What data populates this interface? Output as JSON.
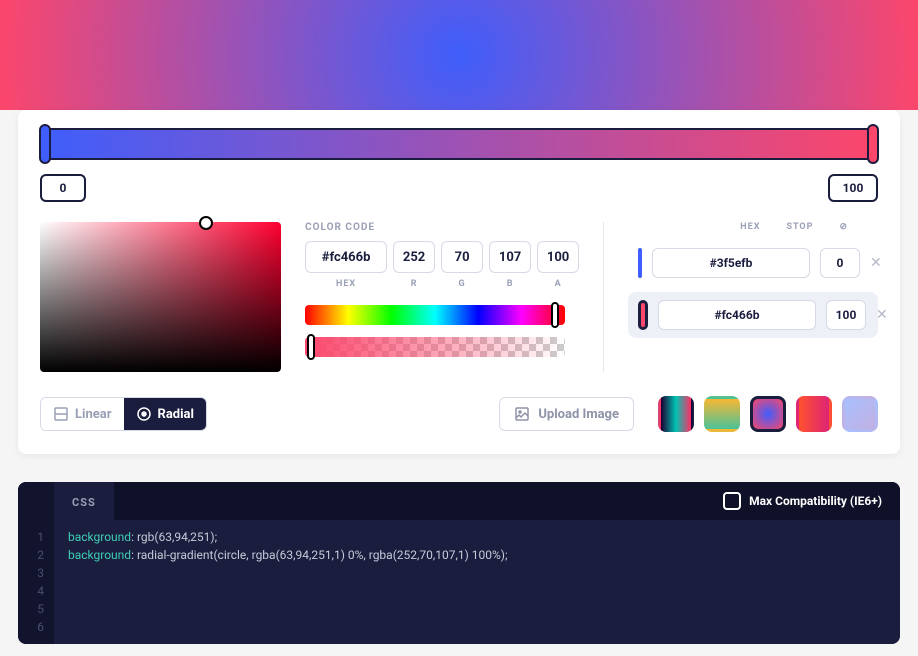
{
  "gradient": {
    "type": "radial",
    "stops": [
      {
        "hex": "#3f5efb",
        "position": 0
      },
      {
        "hex": "#fc466b",
        "position": 100
      }
    ],
    "active_stop_index": 1
  },
  "slider": {
    "left_position": "0",
    "right_position": "100"
  },
  "color_code": {
    "label": "COLOR CODE",
    "hex_label": "HEX",
    "r_label": "R",
    "g_label": "G",
    "b_label": "B",
    "a_label": "A",
    "hex": "#fc466b",
    "r": "252",
    "g": "70",
    "b": "107",
    "a": "100"
  },
  "stops_panel": {
    "hex_header": "HEX",
    "stop_header": "STOP",
    "delete_header": "⊘",
    "rows": [
      {
        "hex": "#3f5efb",
        "pos": "0",
        "color": "#3f5efb",
        "active": false
      },
      {
        "hex": "#fc466b",
        "pos": "100",
        "color": "#fc466b",
        "active": true
      }
    ]
  },
  "type_toggle": {
    "linear_label": "Linear",
    "radial_label": "Radial"
  },
  "upload": {
    "label": "Upload Image"
  },
  "presets": [
    {
      "css": "linear-gradient(90deg,#1a0033,#00c4b4,#ff2e63)"
    },
    {
      "css": "linear-gradient(180deg,#f7b733,#4ac29a)"
    },
    {
      "css": "radial-gradient(circle,#3f5efb,#fc466b)"
    },
    {
      "css": "linear-gradient(90deg,#ff512f,#dd2476)"
    },
    {
      "css": "linear-gradient(135deg,#a8c0ff,#c2b0e2)"
    }
  ],
  "code": {
    "tab_label": "CSS",
    "compat_label": "Max Compatibility (IE6+)",
    "lines": [
      {
        "keyword": "background",
        "rest": ": rgb(63,94,251);"
      },
      {
        "keyword": "background",
        "rest": ": radial-gradient(circle, rgba(63,94,251,1) 0%, rgba(252,70,107,1) 100%);"
      },
      {
        "keyword": "",
        "rest": ""
      },
      {
        "keyword": "",
        "rest": ""
      },
      {
        "keyword": "",
        "rest": ""
      },
      {
        "keyword": "",
        "rest": ""
      }
    ]
  },
  "chart_data": {
    "type": "gradient-editor",
    "gradient_type": "radial",
    "stops": [
      {
        "color": "rgb(63,94,251)",
        "position_pct": 0
      },
      {
        "color": "rgb(252,70,107)",
        "position_pct": 100
      }
    ],
    "active_stop": {
      "hex": "#fc466b",
      "r": 252,
      "g": 70,
      "b": 107,
      "a": 100
    },
    "css_output": "background: radial-gradient(circle, rgba(63,94,251,1) 0%, rgba(252,70,107,1) 100%);"
  }
}
